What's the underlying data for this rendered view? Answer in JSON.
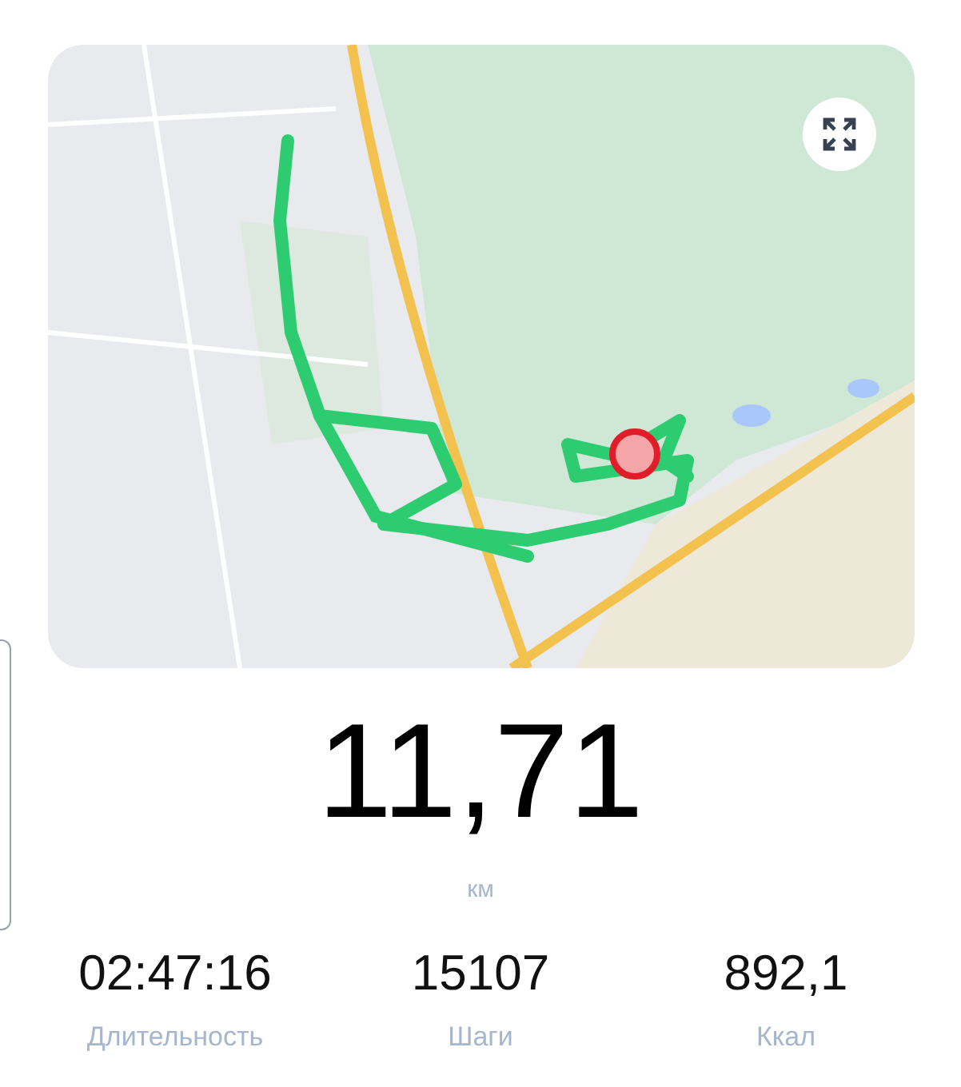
{
  "distance": {
    "value": "11,71",
    "unit": "км"
  },
  "stats": [
    {
      "value": "02:47:16",
      "label": "Длительность"
    },
    {
      "value": "15107",
      "label": "Шаги"
    },
    {
      "value": "892,1",
      "label": "Ккал"
    }
  ]
}
